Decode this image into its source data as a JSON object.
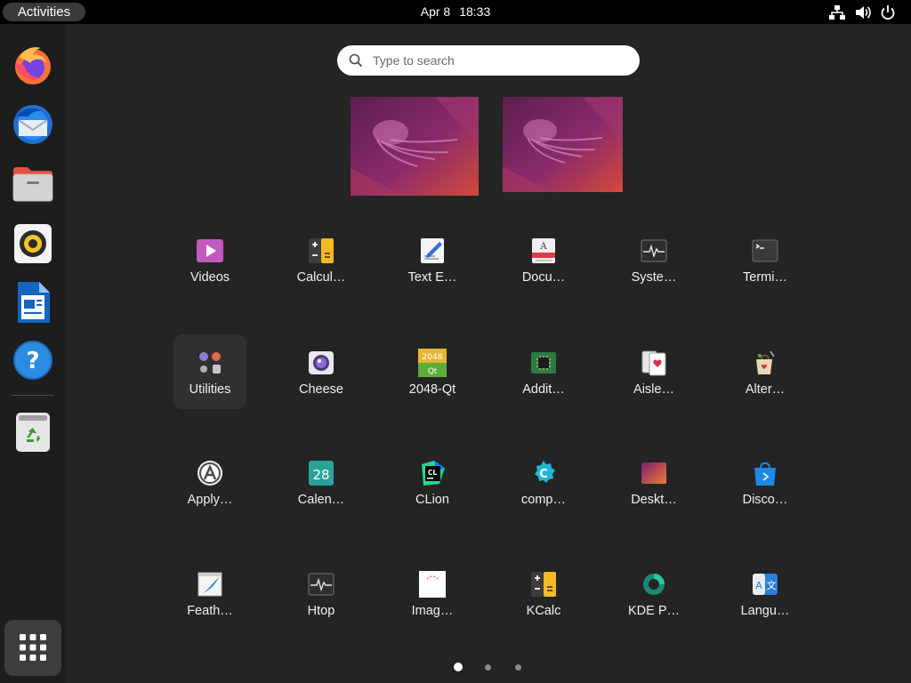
{
  "topbar": {
    "activities_label": "Activities",
    "date": "Apr 8",
    "time": "18:33",
    "icons": [
      "network-icon",
      "volume-icon",
      "power-icon"
    ]
  },
  "search": {
    "placeholder": "Type to search"
  },
  "dash": {
    "items": [
      {
        "name": "firefox",
        "icon": "firefox-icon"
      },
      {
        "name": "thunderbird",
        "icon": "thunderbird-icon"
      },
      {
        "name": "files",
        "icon": "files-icon"
      },
      {
        "name": "rhythmbox",
        "icon": "rhythmbox-icon"
      },
      {
        "name": "libreoffice-writer",
        "icon": "writer-icon"
      },
      {
        "name": "help",
        "icon": "help-icon"
      },
      {
        "name": "trash",
        "icon": "trash-icon"
      }
    ],
    "show_apps_icon": "grid-icon"
  },
  "workspaces": [
    {
      "label": ""
    },
    {
      "label": ""
    }
  ],
  "apps": [
    {
      "label": "Videos",
      "icon": "videos-icon"
    },
    {
      "label": "Calcul…",
      "icon": "calculator-icon"
    },
    {
      "label": "Text E…",
      "icon": "text-editor-icon"
    },
    {
      "label": "Docu…",
      "icon": "document-viewer-icon"
    },
    {
      "label": "Syste…",
      "icon": "system-monitor-icon"
    },
    {
      "label": "Termi…",
      "icon": "terminal-icon"
    },
    {
      "label": "Utilities",
      "icon": "utilities-folder-icon",
      "selected": true
    },
    {
      "label": "Cheese",
      "icon": "cheese-icon"
    },
    {
      "label": "2048-Qt",
      "icon": "game-2048-icon"
    },
    {
      "label": "Addit…",
      "icon": "additional-drivers-icon"
    },
    {
      "label": "Aisle…",
      "icon": "aisleriot-icon"
    },
    {
      "label": "Alter…",
      "icon": "alternatives-icon"
    },
    {
      "label": "Apply…",
      "icon": "apply-icon"
    },
    {
      "label": "Calen…",
      "icon": "calendar-icon"
    },
    {
      "label": "CLion",
      "icon": "clion-icon"
    },
    {
      "label": "comp…",
      "icon": "compiz-icon"
    },
    {
      "label": "Deskt…",
      "icon": "desktop-icon"
    },
    {
      "label": "Disco…",
      "icon": "discover-icon"
    },
    {
      "label": "Feath…",
      "icon": "feather-icon"
    },
    {
      "label": "Htop",
      "icon": "htop-icon"
    },
    {
      "label": "Imag…",
      "icon": "image-viewer-icon"
    },
    {
      "label": "KCalc",
      "icon": "kcalc-icon"
    },
    {
      "label": "KDE P…",
      "icon": "kde-partition-icon"
    },
    {
      "label": "Langu…",
      "icon": "language-support-icon"
    }
  ],
  "calendar_icon_text": "28",
  "game_2048_top": "2048",
  "game_2048_bottom": "Qt",
  "clion_text": "CL",
  "pagination": {
    "pages": 3,
    "current": 1
  },
  "colors": {
    "background": "#242424",
    "topbar": "#000000",
    "dash": "#1d1d1d",
    "accent": "#e95420"
  }
}
